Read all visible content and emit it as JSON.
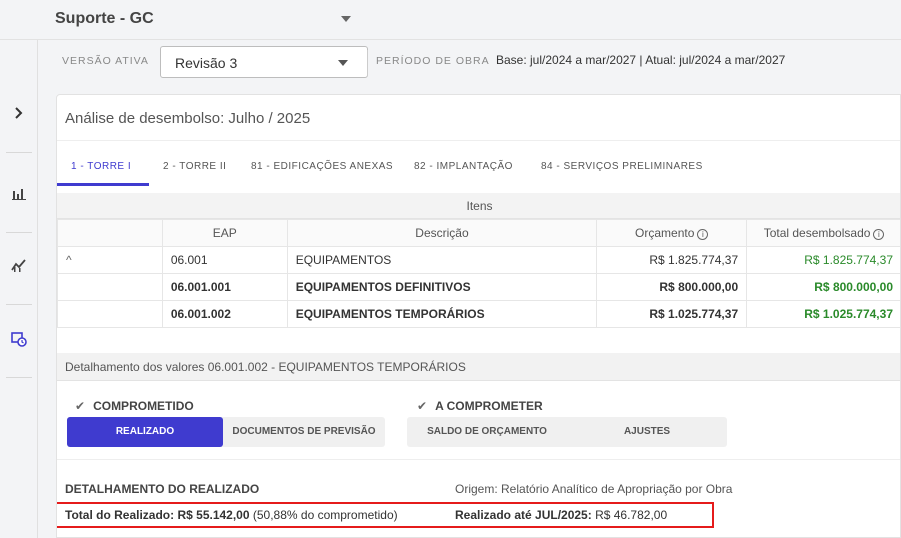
{
  "app": {
    "title": "Suporte - GC"
  },
  "versao": {
    "label": "VERSÃO ATIVA",
    "value": "Revisão 3"
  },
  "periodo": {
    "label": "PERÍODO DE OBRA",
    "value": "Base: jul/2024 a mar/2027 | Atual: jul/2024 a mar/2027"
  },
  "card": {
    "heading": "Análise de desembolso: Julho / 2025",
    "tabs": [
      {
        "label": "1 - TORRE I",
        "active": true
      },
      {
        "label": "2 - TORRE II"
      },
      {
        "label": "81 - EDIFICAÇÕES ANEXAS"
      },
      {
        "label": "82 - IMPLANTAÇÃO"
      },
      {
        "label": "84 - SERVIÇOS PRELIMINARES"
      }
    ],
    "items_header": "Itens",
    "columns": {
      "eap": "EAP",
      "descricao": "Descrição",
      "orcamento": "Orçamento",
      "total": "Total desembolsado"
    },
    "rows": [
      {
        "toggle": "^",
        "eap": "06.001",
        "descricao": "EQUIPAMENTOS",
        "orcamento": "R$ 1.825.774,37",
        "total": "R$ 1.825.774,37"
      },
      {
        "toggle": "",
        "eap": "06.001.001",
        "descricao": "EQUIPAMENTOS DEFINITIVOS",
        "orcamento": "R$ 800.000,00",
        "total": "R$ 800.000,00"
      },
      {
        "toggle": "",
        "eap": "06.001.002",
        "descricao": "EQUIPAMENTOS TEMPORÁRIOS",
        "orcamento": "R$ 1.025.774,37",
        "total": "R$ 1.025.774,37"
      }
    ]
  },
  "detail": {
    "header": "Detalhamento dos valores 06.001.002 - EQUIPAMENTOS TEMPORÁRIOS",
    "comprometido": {
      "title": "COMPROMETIDO",
      "btn_realizado": "REALIZADO",
      "btn_documentos": "DOCUMENTOS DE PREVISÃO"
    },
    "a_comprometer": {
      "title": "A COMPROMETER",
      "btn_saldo": "SALDO DE ORÇAMENTO",
      "btn_ajustes": "AJUSTES"
    },
    "realizado_title": "DETALHAMENTO DO REALIZADO",
    "origem": "Origem: Relatório Analítico de Apropriação por Obra",
    "total_label": "Total do Realizado:",
    "total_value": "R$ 55.142,00",
    "total_pct": "(50,88% do comprometido)",
    "ate_label": "Realizado até JUL/2025:",
    "ate_value": "R$ 46.782,00"
  },
  "colors": {
    "accent": "#3f3bcf",
    "green": "#2a8a2a",
    "highlight": "#e51b1b"
  }
}
